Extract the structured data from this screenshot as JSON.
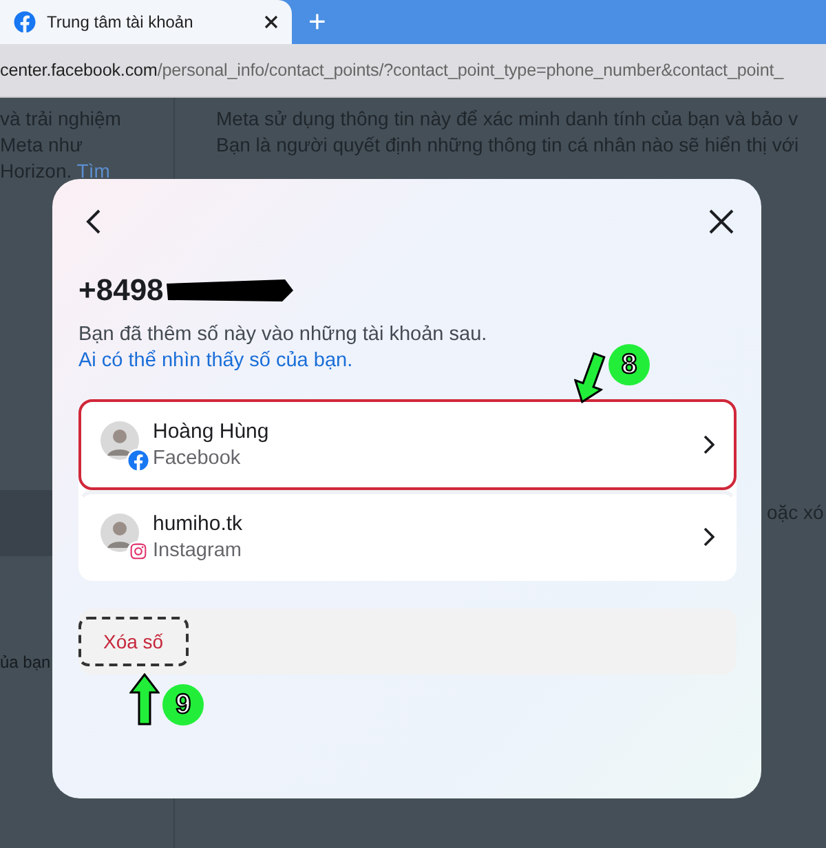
{
  "browser": {
    "tab": {
      "title": "Trung tâm tài khoản",
      "selected": true
    },
    "new_tab": "+",
    "url": {
      "host": "center.facebook.com",
      "path": "/personal_info/contact_points/?contact_point_type=phone_number&contact_point_"
    }
  },
  "background_page": {
    "left_lines": [
      "và trải nghiệm",
      "Meta như",
      "Horizon."
    ],
    "left_link": "Tìm",
    "right_lines": [
      "Meta sử dụng thông tin này để xác minh danh tính của bạn và bảo v",
      "Bạn là người quyết định những thông tin cá nhân nào sẽ hiển thị với"
    ],
    "left_fragment": "ủa bạn",
    "right_fragment": "oặc xó"
  },
  "dialog": {
    "phone": "+8498",
    "redacted": true,
    "description": "Bạn đã thêm số này vào những tài khoản sau.",
    "link": "Ai có thể nhìn thấy số của bạn.",
    "accounts": [
      {
        "name": "Hoàng Hùng",
        "platform": "Facebook",
        "kind": "facebook",
        "highlighted": true
      },
      {
        "name": "humiho.tk",
        "platform": "Instagram",
        "kind": "instagram",
        "highlighted": false
      }
    ],
    "delete": {
      "label": "Xóa số",
      "highlighted": true
    }
  },
  "callouts": [
    {
      "label": "8",
      "kind": "down"
    },
    {
      "label": "9",
      "kind": "up"
    }
  ]
}
